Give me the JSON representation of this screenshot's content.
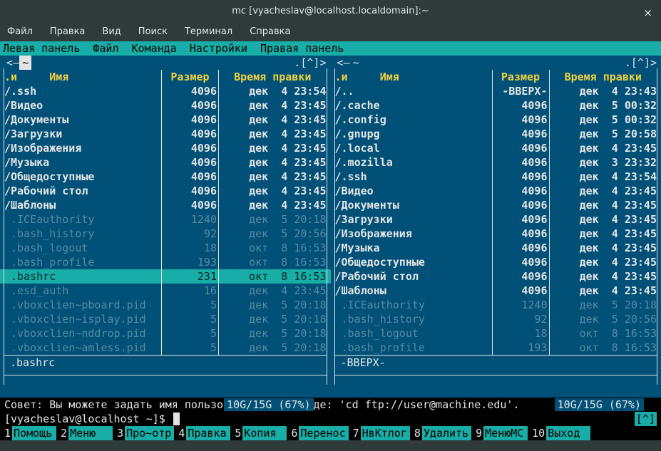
{
  "window": {
    "title": "mc [vyacheslav@localhost.localdomain]:~",
    "close_symbol": "×"
  },
  "app_menu": {
    "items": [
      "Файл",
      "Правка",
      "Вид",
      "Поиск",
      "Терминал",
      "Справка"
    ]
  },
  "mc_menu": {
    "items": [
      "Левая панель",
      "Файл",
      "Команда",
      "Настройки",
      "Правая панель"
    ]
  },
  "panel_header": {
    "name_prefix": ".и",
    "name": "Имя",
    "size": "Размер",
    "mtime": "Время правки"
  },
  "left_panel": {
    "path_marker": "<—— ",
    "path": "~",
    "arrows": ".[^]>",
    "status": ".bashrc",
    "disk": "10G/15G (67%)",
    "rows": [
      {
        "name": "/.ssh",
        "size": "4096",
        "mtime": "дек  4 23:54",
        "cls": "dir"
      },
      {
        "name": "/Видео",
        "size": "4096",
        "mtime": "дек  4 23:45",
        "cls": "dir"
      },
      {
        "name": "/Документы",
        "size": "4096",
        "mtime": "дек  4 23:45",
        "cls": "dir"
      },
      {
        "name": "/Загрузки",
        "size": "4096",
        "mtime": "дек  4 23:45",
        "cls": "dir"
      },
      {
        "name": "/Изображения",
        "size": "4096",
        "mtime": "дек  4 23:45",
        "cls": "dir"
      },
      {
        "name": "/Музыка",
        "size": "4096",
        "mtime": "дек  4 23:45",
        "cls": "dir"
      },
      {
        "name": "/Общедоступные",
        "size": "4096",
        "mtime": "дек  4 23:45",
        "cls": "dir"
      },
      {
        "name": "/Рабочий стол",
        "size": "4096",
        "mtime": "дек  4 23:45",
        "cls": "dir"
      },
      {
        "name": "/Шаблоны",
        "size": "4096",
        "mtime": "дек  4 23:45",
        "cls": "dir"
      },
      {
        "name": " .ICEauthority",
        "size": "1240",
        "mtime": "дек  5 20:18",
        "cls": "dim"
      },
      {
        "name": " .bash_history",
        "size": "92",
        "mtime": "дек  5 20:56",
        "cls": "dim"
      },
      {
        "name": " .bash_logout",
        "size": "18",
        "mtime": "окт  8 16:53",
        "cls": "dim"
      },
      {
        "name": " .bash_profile",
        "size": "193",
        "mtime": "окт  8 16:53",
        "cls": "dim"
      },
      {
        "name": " .bashrc",
        "size": "231",
        "mtime": "окт  8 16:53",
        "cls": "sel"
      },
      {
        "name": " .esd_auth",
        "size": "16",
        "mtime": "дек  4 23:45",
        "cls": "dim"
      },
      {
        "name": " .vboxclien~pboard.pid",
        "size": "5",
        "mtime": "дек  5 20:18",
        "cls": "dim"
      },
      {
        "name": " .vboxclien~isplay.pid",
        "size": "5",
        "mtime": "дек  5 20:18",
        "cls": "dim"
      },
      {
        "name": " .vboxclien~nddrop.pid",
        "size": "5",
        "mtime": "дек  5 20:18",
        "cls": "dim"
      },
      {
        "name": " .vboxclien~amless.pid",
        "size": "5",
        "mtime": "дек  5 20:18",
        "cls": "dim"
      }
    ]
  },
  "right_panel": {
    "path_marker": "<—— ",
    "path": "~",
    "arrows": ".[^]>",
    "status": "-ВВЕРХ-",
    "disk": "10G/15G (67%)",
    "rows": [
      {
        "name": "/..",
        "size": "-ВВЕРХ-",
        "mtime": "дек  4 23:43",
        "cls": "dir"
      },
      {
        "name": "/.cache",
        "size": "4096",
        "mtime": "дек  5 00:32",
        "cls": "dir"
      },
      {
        "name": "/.config",
        "size": "4096",
        "mtime": "дек  5 00:32",
        "cls": "dir"
      },
      {
        "name": "/.gnupg",
        "size": "4096",
        "mtime": "дек  5 20:58",
        "cls": "dir"
      },
      {
        "name": "/.local",
        "size": "4096",
        "mtime": "дек  4 23:45",
        "cls": "dir"
      },
      {
        "name": "/.mozilla",
        "size": "4096",
        "mtime": "дек  3 23:32",
        "cls": "dir"
      },
      {
        "name": "/.ssh",
        "size": "4096",
        "mtime": "дек  4 23:54",
        "cls": "dir"
      },
      {
        "name": "/Видео",
        "size": "4096",
        "mtime": "дек  4 23:45",
        "cls": "dir"
      },
      {
        "name": "/Документы",
        "size": "4096",
        "mtime": "дек  4 23:45",
        "cls": "dir"
      },
      {
        "name": "/Загрузки",
        "size": "4096",
        "mtime": "дек  4 23:45",
        "cls": "dir"
      },
      {
        "name": "/Изображения",
        "size": "4096",
        "mtime": "дек  4 23:45",
        "cls": "dir"
      },
      {
        "name": "/Музыка",
        "size": "4096",
        "mtime": "дек  4 23:45",
        "cls": "dir"
      },
      {
        "name": "/Общедоступные",
        "size": "4096",
        "mtime": "дек  4 23:45",
        "cls": "dir"
      },
      {
        "name": "/Рабочий стол",
        "size": "4096",
        "mtime": "дек  4 23:45",
        "cls": "dir"
      },
      {
        "name": "/Шаблоны",
        "size": "4096",
        "mtime": "дек  4 23:45",
        "cls": "dir"
      },
      {
        "name": " .ICEauthority",
        "size": "1240",
        "mtime": "дек  5 20:18",
        "cls": "dim"
      },
      {
        "name": " .bash_history",
        "size": "92",
        "mtime": "дек  5 20:56",
        "cls": "dim"
      },
      {
        "name": " .bash_logout",
        "size": "18",
        "mtime": "окт  8 16:53",
        "cls": "dim"
      },
      {
        "name": " .bash_profile",
        "size": "193",
        "mtime": "окт  8 16:53",
        "cls": "dim"
      }
    ]
  },
  "hint": "Совет: Вы можете задать имя пользователя в команде: 'cd ftp://user@machine.edu'.",
  "prompt": "[vyacheslav@localhost ~]$ ",
  "prompt_caret": "[^]",
  "fkeys": [
    {
      "n": "1",
      "l": "Помощь"
    },
    {
      "n": "2",
      "l": "Меню"
    },
    {
      "n": "3",
      "l": "Про~отр"
    },
    {
      "n": "4",
      "l": "Правка"
    },
    {
      "n": "5",
      "l": "Копия"
    },
    {
      "n": "6",
      "l": "Перенос"
    },
    {
      "n": "7",
      "l": "НвКтлог"
    },
    {
      "n": "8",
      "l": "Удалить"
    },
    {
      "n": "9",
      "l": "МенюMC"
    },
    {
      "n": "10",
      "l": "Выход"
    }
  ]
}
